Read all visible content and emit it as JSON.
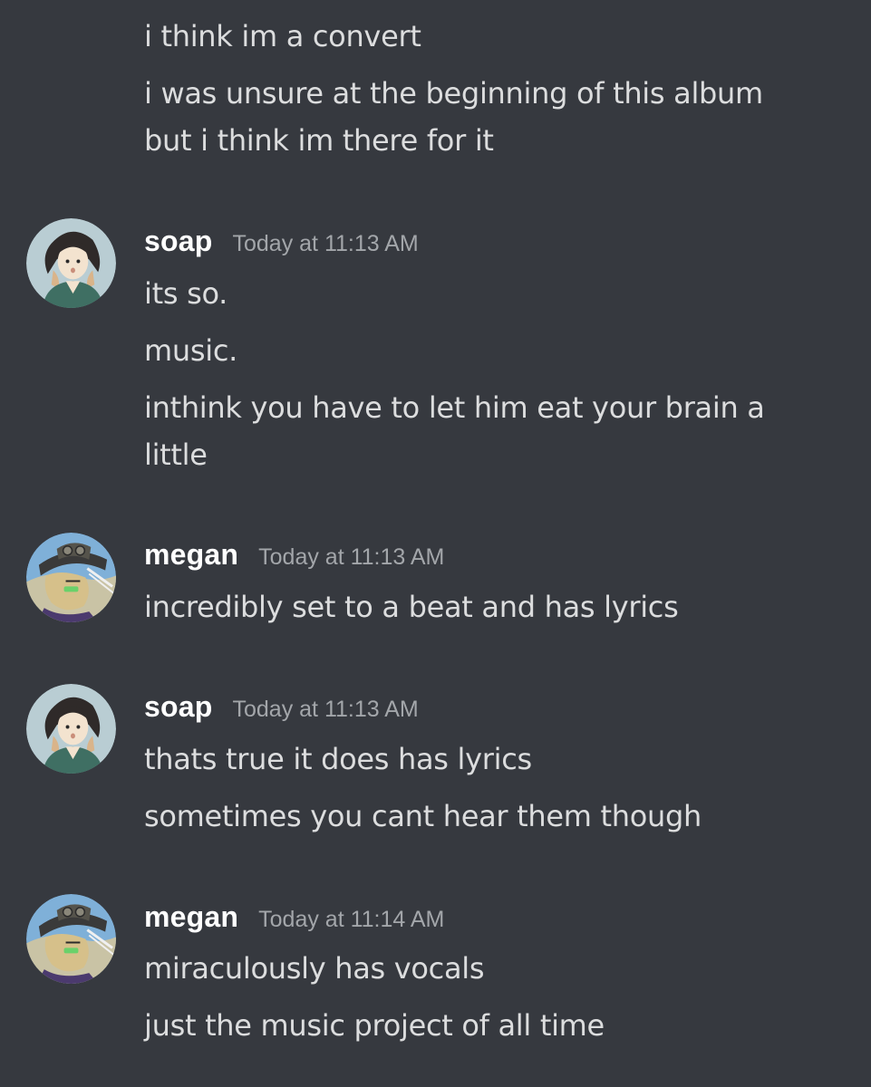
{
  "messages": {
    "continuation": [
      "i think im a convert",
      "i was unsure at the beginning of this album",
      "but i think im there for it"
    ],
    "groups": [
      {
        "username": "soap",
        "timestamp": "Today at 11:13 AM",
        "avatar_icon": "girl-portrait-avatar",
        "lines": [
          "its so.",
          "music.",
          "inthink you have to let him eat your brain a",
          "little"
        ]
      },
      {
        "username": "megan",
        "timestamp": "Today at 11:13 AM",
        "avatar_icon": "hat-character-avatar",
        "lines": [
          "incredibly set to a beat and has lyrics"
        ]
      },
      {
        "username": "soap",
        "timestamp": "Today at 11:13 AM",
        "avatar_icon": "girl-portrait-avatar",
        "lines": [
          "thats true it does has lyrics",
          "sometimes you cant hear them though"
        ]
      },
      {
        "username": "megan",
        "timestamp": "Today at 11:14 AM",
        "avatar_icon": "hat-character-avatar",
        "lines": [
          "miraculously has vocals",
          "just the music project of all time"
        ]
      }
    ]
  },
  "colors": {
    "background": "#36393f",
    "message_text": "#dcddde",
    "username": "#ffffff",
    "timestamp": "#a3a6aa"
  }
}
